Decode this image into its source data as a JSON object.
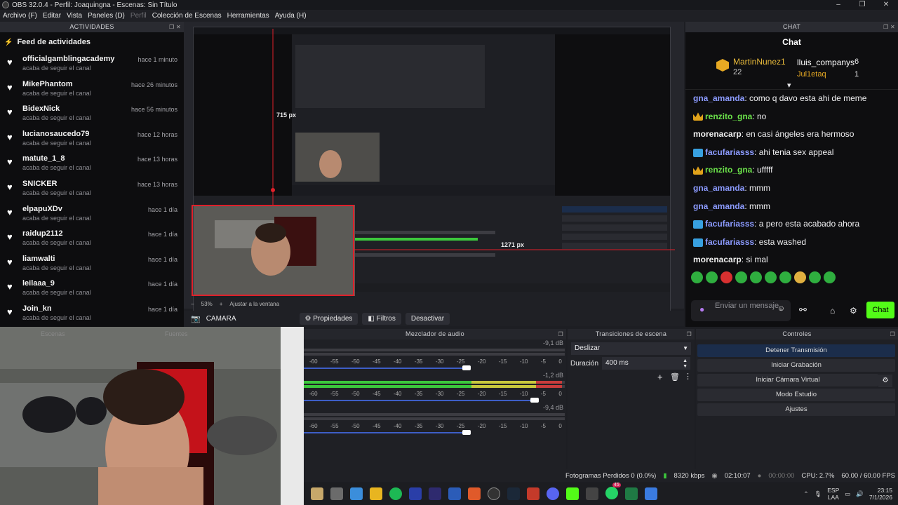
{
  "window": {
    "title": "OBS 32.0.4 - Perfil: Joaquingna - Escenas: Sin Título",
    "controls": [
      "–",
      "❐",
      "✕"
    ]
  },
  "menu": [
    "Archivo (F)",
    "Editar",
    "Vista",
    "Paneles (D)",
    "Perfil",
    "Colección de Escenas",
    "Herramientas",
    "Ayuda (H)"
  ],
  "activity_dock": {
    "header": "ACTIVIDADES",
    "feed_title": "Feed de actividades",
    "items": [
      {
        "name": "officialgamblingacademy",
        "sub": "acaba de seguir el canal",
        "time": "hace 1 minuto"
      },
      {
        "name": "MikePhantom",
        "sub": "acaba de seguir el canal",
        "time": "hace 26 minutos"
      },
      {
        "name": "BidexNick",
        "sub": "acaba de seguir el canal",
        "time": "hace 56 minutos"
      },
      {
        "name": "lucianosaucedo79",
        "sub": "acaba de seguir el canal",
        "time": "hace 12 horas"
      },
      {
        "name": "matute_1_8",
        "sub": "acaba de seguir el canal",
        "time": "hace 13 horas"
      },
      {
        "name": "SNICKER",
        "sub": "acaba de seguir el canal",
        "time": "hace 13 horas"
      },
      {
        "name": "elpapuXDv",
        "sub": "acaba de seguir el canal",
        "time": "hace 1 día"
      },
      {
        "name": "raidup2112",
        "sub": "acaba de seguir el canal",
        "time": "hace 1 día"
      },
      {
        "name": "liamwalti",
        "sub": "acaba de seguir el canal",
        "time": "hace 1 día"
      },
      {
        "name": "leilaaa_9",
        "sub": "acaba de seguir el canal",
        "time": "hace 1 día"
      },
      {
        "name": "Join_kn",
        "sub": "acaba de seguir el canal",
        "time": "hace 1 día"
      }
    ]
  },
  "preview": {
    "dim_width": "715 px",
    "dim_height": "1271 px",
    "zoom": "53%",
    "fit_label": "Ajustar a la ventana"
  },
  "source_bar": {
    "source_name": "CAMARA",
    "properties": "Propiedades",
    "filters": "Filtros",
    "deactivate": "Desactivar"
  },
  "chat_dock": {
    "header": "CHAT",
    "title": "Chat",
    "leaders": [
      {
        "name": "MartinNunez1",
        "count": "22"
      },
      {
        "name": "lluis_companys",
        "count": "6"
      },
      {
        "name": "Jul1etaq",
        "count": "1"
      }
    ],
    "messages": [
      {
        "user": "gna_amanda",
        "text": ": como q davo esta ahi de meme",
        "color": "#8c9bff",
        "badge": ""
      },
      {
        "user": "renzito_gna",
        "text": ": no",
        "color": "#6be24a",
        "badge": "crown"
      },
      {
        "user": "morenacarp",
        "text": ": en casi ángeles era hermoso",
        "color": "#f0f0f0",
        "badge": ""
      },
      {
        "user": "facufariasss",
        "text": ": ahi tenia sex appeal",
        "color": "#8c9bff",
        "badge": "prime"
      },
      {
        "user": "renzito_gna",
        "text": ": ufffff",
        "color": "#6be24a",
        "badge": "crown"
      },
      {
        "user": "gna_amanda",
        "text": ": mmm",
        "color": "#8c9bff",
        "badge": ""
      },
      {
        "user": "gna_amanda",
        "text": ": mmm",
        "color": "#8c9bff",
        "badge": ""
      },
      {
        "user": "facufariasss",
        "text": ": a pero esta acabado ahora",
        "color": "#8c9bff",
        "badge": "prime"
      },
      {
        "user": "facufariasss",
        "text": ": esta washed",
        "color": "#8c9bff",
        "badge": "prime"
      },
      {
        "user": "morenacarp",
        "text": ": si mal",
        "color": "#f0f0f0",
        "badge": ""
      }
    ],
    "input_placeholder": "Enviar un mensaje",
    "send_label": "Chat"
  },
  "docks": {
    "scenes": "Escenas",
    "sources": "Fuentes",
    "mixer": "Mezclador de audio",
    "transitions": "Transiciones de escena",
    "controls": "Controles"
  },
  "mixer": {
    "channels": [
      {
        "db": "-9,1 dB",
        "volume_fraction": 0.62,
        "level_fraction": 0.0
      },
      {
        "db": "-1,2 dB",
        "volume_fraction": 0.88,
        "level_fraction": 0.99
      },
      {
        "db": "-9,4 dB",
        "volume_fraction": 0.62,
        "level_fraction": 0.0
      }
    ],
    "scale": [
      "-60",
      "-55",
      "-50",
      "-45",
      "-40",
      "-35",
      "-30",
      "-25",
      "-20",
      "-15",
      "-10",
      "-5",
      "0"
    ]
  },
  "transitions": {
    "selected": "Deslizar",
    "duration_label": "Duración",
    "duration_value": "400 ms"
  },
  "controls": {
    "buttons": [
      "Detener Transmisión",
      "Iniciar Grabación",
      "Iniciar Cámara Virtual",
      "Modo Estudio",
      "Ajustes"
    ]
  },
  "status": {
    "dropped": "Fotogramas Perdidos 0 (0.0%)",
    "bitrate": "8320 kbps",
    "stream_time": "02:10:07",
    "rec_time": "00:00:00",
    "cpu": "CPU: 2.7%",
    "fps": "60.00 / 60.00 FPS"
  },
  "taskbar": {
    "lang": "ESP",
    "lang2": "LAA",
    "time": "23:15",
    "date": "7/1/2026",
    "badge_count": "45"
  }
}
